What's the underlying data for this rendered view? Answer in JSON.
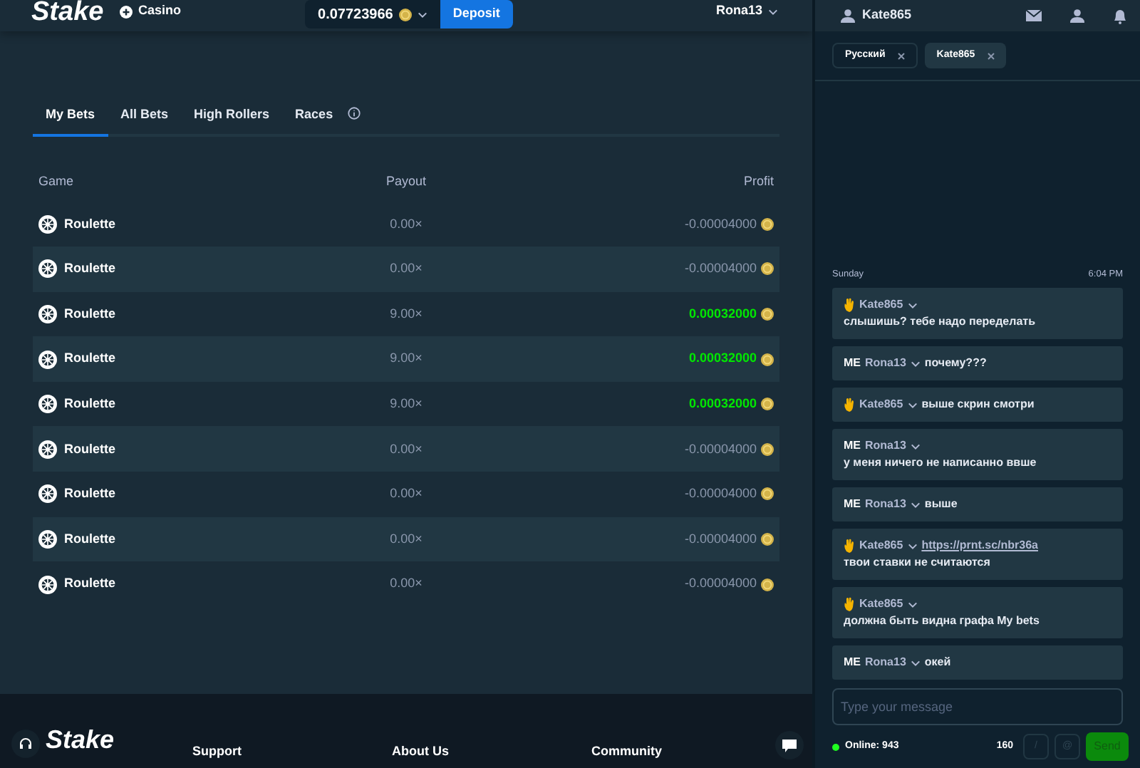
{
  "header": {
    "logo": "Stake",
    "section": "Casino",
    "balance": "0.07723966",
    "deposit": "Deposit",
    "user": "Rona13"
  },
  "tabs": [
    {
      "label": "My Bets",
      "selected": true
    },
    {
      "label": "All Bets",
      "selected": false
    },
    {
      "label": "High Rollers",
      "selected": false
    },
    {
      "label": "Races",
      "selected": false
    }
  ],
  "table": {
    "columns": [
      "Game",
      "Payout",
      "Profit"
    ],
    "rows": [
      {
        "game": "Roulette",
        "payout": "0.00×",
        "profit": "-0.00004000",
        "win": false
      },
      {
        "game": "Roulette",
        "payout": "0.00×",
        "profit": "-0.00004000",
        "win": false
      },
      {
        "game": "Roulette",
        "payout": "9.00×",
        "profit": "0.00032000",
        "win": true
      },
      {
        "game": "Roulette",
        "payout": "9.00×",
        "profit": "0.00032000",
        "win": true
      },
      {
        "game": "Roulette",
        "payout": "9.00×",
        "profit": "0.00032000",
        "win": true
      },
      {
        "game": "Roulette",
        "payout": "0.00×",
        "profit": "-0.00004000",
        "win": false
      },
      {
        "game": "Roulette",
        "payout": "0.00×",
        "profit": "-0.00004000",
        "win": false
      },
      {
        "game": "Roulette",
        "payout": "0.00×",
        "profit": "-0.00004000",
        "win": false
      },
      {
        "game": "Roulette",
        "payout": "0.00×",
        "profit": "-0.00004000",
        "win": false
      }
    ]
  },
  "footer": {
    "logo": "Stake",
    "columns": [
      "Support",
      "About Us",
      "Community"
    ]
  },
  "chat": {
    "user": "Kate865",
    "rooms": [
      {
        "label": "Русский",
        "selected": false
      },
      {
        "label": "Kate865",
        "selected": true
      }
    ],
    "day": "Sunday",
    "time": "6:04 PM",
    "messages": [
      {
        "kind": "other",
        "author": "Kate865",
        "text": "слышишь? тебе надо переделать"
      },
      {
        "kind": "me",
        "badge": "ME",
        "author": "Rona13",
        "text": "почему???"
      },
      {
        "kind": "other",
        "author": "Kate865",
        "text": "выше скрин смотри"
      },
      {
        "kind": "me",
        "badge": "ME",
        "author": "Rona13",
        "text": "у меня ничего не написанно ввше"
      },
      {
        "kind": "me",
        "badge": "ME",
        "author": "Rona13",
        "text": "выше"
      },
      {
        "kind": "other",
        "author": "Kate865",
        "link": "https://prnt.sc/nbr36a",
        "text": "твои ставки не считаются"
      },
      {
        "kind": "other",
        "author": "Kate865",
        "text": "должна быть видна графа My bets"
      },
      {
        "kind": "me",
        "badge": "ME",
        "author": "Rona13",
        "text": "окей"
      }
    ],
    "input": {
      "placeholder": "Type your message"
    },
    "online": "Online: 943",
    "count": "160",
    "buttons": [
      "/",
      "@"
    ],
    "send": "Send"
  }
}
